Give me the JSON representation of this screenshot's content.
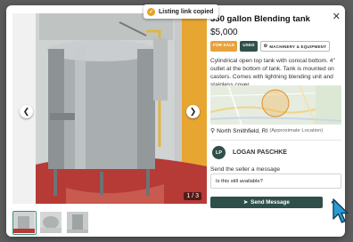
{
  "toast": {
    "text": "Listing link copied"
  },
  "listing": {
    "title": "350 gallon Blending tank",
    "price": "$5,000",
    "badges": {
      "sale": "FOR SALE",
      "condition": "USED",
      "category": "MACHINERY & EQUIPMENT"
    },
    "description": "Cylindrical open top tank with conical bottom. 4\" outlet at the bottom of tank. Tank is mounted on casters. Comes with lightning blending unit and stainless cover",
    "location": "North Smithfield, RI",
    "location_note": "(Approximate Location)"
  },
  "gallery": {
    "counter": "1 / 3",
    "thumb_count": 3
  },
  "seller": {
    "initials": "LP",
    "name": "LOGAN PASCHKE"
  },
  "message": {
    "label": "Send the seller a message",
    "value": "Is this still available?",
    "send_label": "Send Message"
  },
  "icons": {
    "close": "close-icon",
    "check": "check-icon",
    "prev": "chevron-left-icon",
    "next": "chevron-right-icon",
    "location": "location-pin-icon",
    "category": "gear-icon",
    "send": "send-icon",
    "share": "share-icon"
  },
  "colors": {
    "accent": "#2f4f4a",
    "sale": "#e8a23a",
    "toast_check": "#e2a223"
  }
}
